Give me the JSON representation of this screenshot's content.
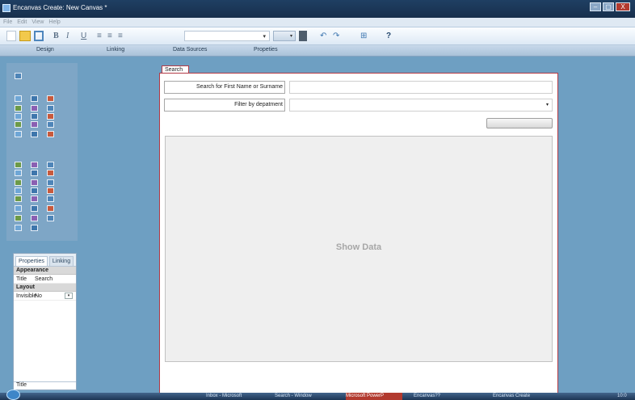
{
  "window": {
    "title": "Encanvas Create: New Canvas *",
    "minimize": "–",
    "maximize": "▢",
    "close": "X"
  },
  "menu": [
    "File",
    "Edit",
    "View",
    "Help"
  ],
  "toolbar": {
    "bold": "B",
    "italic": "I",
    "underline": "U",
    "align_left": "≡",
    "align_center": "≡",
    "align_right": "≡",
    "font_value": "▾",
    "size_value": "▾",
    "undo": "↶",
    "redo": "↷",
    "grid": "⊞",
    "help": "?"
  },
  "modes": [
    "Design",
    "Linking",
    "Data Sources",
    "Propeties"
  ],
  "properties": {
    "tabs": [
      "Properties",
      "Linking"
    ],
    "appearance_header": "Appearance",
    "title_key": "Title",
    "title_value": "Search",
    "layout_header": "Layout",
    "invisible_key": "Invisible",
    "invisible_value": "No",
    "invisible_dropdown": "▾",
    "footer": "Title"
  },
  "canvas": {
    "tab_label": "Search",
    "search_label": "Search for First Name or Surname",
    "filter_label": "Filter by depatment",
    "filter_arrow": "▾",
    "show_data": "Show Data"
  },
  "taskbar": {
    "items": [
      "Inbox - Microsoft",
      "Search - Window",
      "Microsoft PowerP",
      "Encanvas??",
      "Encanvas Create"
    ],
    "clock": "10:0"
  },
  "colors": {
    "accent": "#b23a45",
    "title_bar": "#1f3f63",
    "workspace": "#6e9fc2"
  }
}
